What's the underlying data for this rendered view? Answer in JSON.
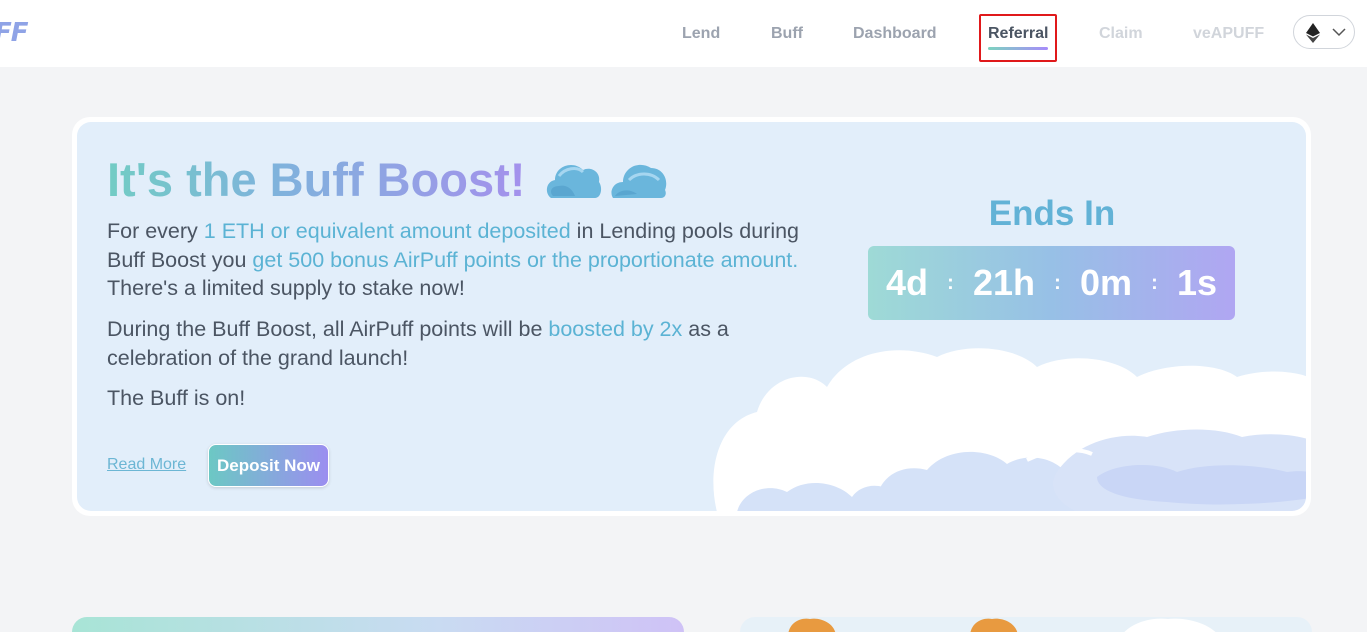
{
  "header": {
    "logo_text": "FF",
    "nav": [
      {
        "label": "Lend",
        "state": "normal"
      },
      {
        "label": "Buff",
        "state": "normal"
      },
      {
        "label": "Dashboard",
        "state": "normal"
      },
      {
        "label": "Referral",
        "state": "active"
      },
      {
        "label": "Claim",
        "state": "dim"
      },
      {
        "label": "veAPUFF",
        "state": "dim"
      }
    ],
    "chain_icon": "ethereum-icon",
    "chain_dropdown_icon": "chevron-down-icon"
  },
  "hero": {
    "title": "It's the Buff Boost!",
    "title_icons": [
      "cloud-icon",
      "cloud-icon"
    ],
    "para1": {
      "t1": "For every ",
      "a1": "1 ETH or equivalent amount deposited",
      "t2": " in Lending pools during Buff Boost you ",
      "a2": "get 500 bonus AirPuff points or the proportionate amount.",
      "t3": " There's a limited supply to stake now!"
    },
    "para2": {
      "t1": "During the Buff Boost, all AirPuff points will be ",
      "a1": "boosted by 2x",
      "t2": " as a celebration of the grand launch!"
    },
    "para3": "The Buff is on!",
    "read_more": "Read More",
    "deposit_button": "Deposit Now",
    "ends_in": "Ends In",
    "timer": {
      "days": "4d",
      "hours": "21h",
      "minutes": "0m",
      "seconds": "1s",
      "separator": ":"
    }
  },
  "colors": {
    "accent": "#5bb3d4",
    "gradient_start": "#72ccc4",
    "gradient_end": "#a491ec",
    "highlight_box": "#e0191b"
  }
}
